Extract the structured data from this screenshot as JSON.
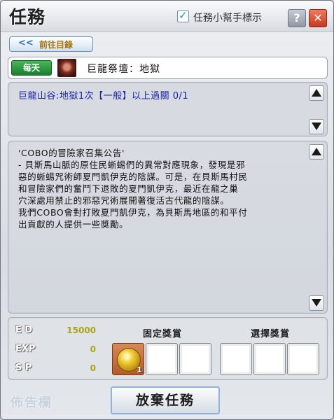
{
  "window": {
    "title": "任務"
  },
  "header": {
    "helper_checkbox_label": "任務小幫手標示",
    "help_label": "?",
    "close_label": "✕"
  },
  "nav": {
    "back_arrow": "<<",
    "back_label": "前往目錄"
  },
  "quest": {
    "type_badge": "每天",
    "icon": "dragon-emblem-icon",
    "name": "巨龍祭壇：地獄"
  },
  "objective": {
    "text": "巨龍山谷:地獄1次【一般】以上過關 0/1"
  },
  "description": {
    "lines": [
      "'COBO的冒險家召集公告'",
      "- 貝斯馬山脈的原住民蜥蜴們的異常對應現象，發現是邪",
      "惡的蜥蜴咒術師夏門凱伊克的陰謀。可是，在貝斯馬村民",
      "和冒險家們的奮鬥下退敗的夏門凱伊克，最近在龍之巢",
      "穴深處用禁止的邪惡咒術展開著復活古代龍的陰謀。",
      "我們COBO會對打敗夏門凱伊克，為貝斯馬地區的和平付",
      "出貢獻的人提供一些獎勵。"
    ]
  },
  "rewards": {
    "ed_label": "E D",
    "ed_value": "15000",
    "exp_label": "EXP",
    "exp_value": "0",
    "sp_label": "S P",
    "sp_value": "0",
    "fixed_header": "固定獎賞",
    "choice_header": "選擇獎賞",
    "fixed_item_count": "1"
  },
  "footer": {
    "bulletin_label": "佈告欄",
    "abandon_label": "放棄任務"
  }
}
